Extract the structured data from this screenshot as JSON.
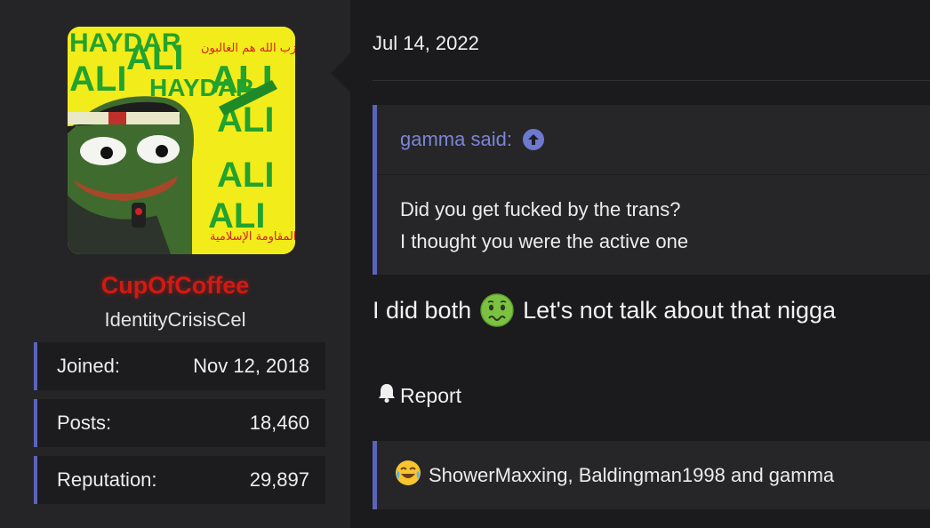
{
  "user": {
    "username": "CupOfCoffee",
    "title": "IdentityCrisisCel",
    "avatar_text": [
      "HAYDAR",
      "ALI",
      "ALI",
      "HAYDAR",
      "ALI",
      "ALI",
      "ALI",
      "ALI"
    ],
    "avatar_arabic": [
      "حزب الله هم الغالبون",
      "المقاومة الإسلامية"
    ],
    "stats": [
      {
        "label": "Joined:",
        "value": "Nov 12, 2018"
      },
      {
        "label": "Posts:",
        "value": "18,460"
      },
      {
        "label": "Reputation:",
        "value": "29,897"
      }
    ]
  },
  "post": {
    "date": "Jul 14, 2022",
    "quote": {
      "author_label": "gamma said:",
      "lines": [
        "Did you get fucked by the trans?",
        "I thought you were the active one"
      ]
    },
    "message_before": "I did both",
    "message_emoji": "nauseated-face-icon",
    "message_after": "Let's not talk about that nigga",
    "report_label": "Report",
    "reactions": {
      "emoji": "joy-face-icon",
      "text": "ShowerMaxxing, Baldingman1998 and gamma"
    }
  },
  "colors": {
    "accent": "#5a64b8",
    "username": "#d11a12",
    "quote_author": "#7b85d6"
  }
}
